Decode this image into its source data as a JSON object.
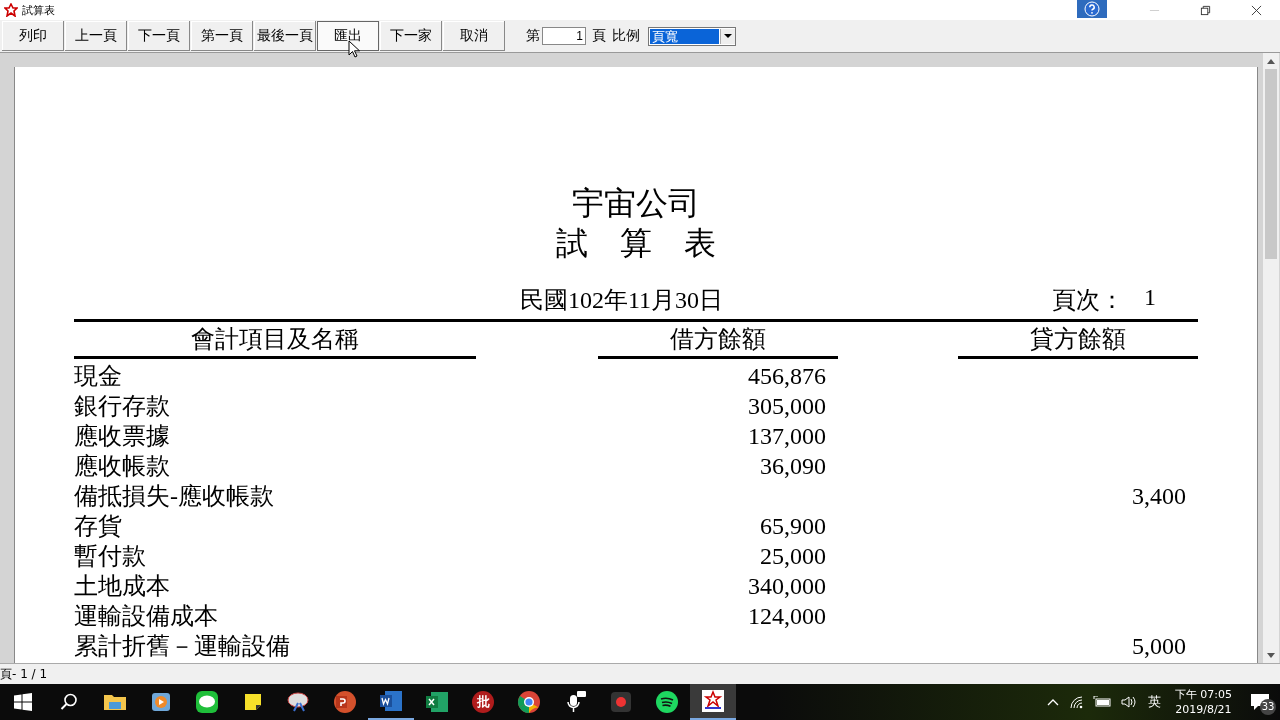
{
  "window": {
    "title": "試算表"
  },
  "toolbar": {
    "buttons": [
      {
        "label": "列印",
        "hovered": false
      },
      {
        "label": "上一頁",
        "hovered": false
      },
      {
        "label": "下一頁",
        "hovered": false
      },
      {
        "label": "第一頁",
        "hovered": false
      },
      {
        "label": "最後一頁",
        "hovered": false
      },
      {
        "label": "匯出",
        "hovered": true
      },
      {
        "label": "下一家",
        "hovered": false
      },
      {
        "label": "取消",
        "hovered": false
      }
    ],
    "page_prefix": "第",
    "page_value": "1",
    "page_suffix": "頁",
    "zoom_label": "比例",
    "zoom_value": "頁寬"
  },
  "report": {
    "company": "宇宙公司",
    "title": "試　算　表",
    "date": "民國102年11月30日",
    "page_label": "頁次：",
    "page_number": "1",
    "columns": [
      "會計項目及名稱",
      "借方餘額",
      "貸方餘額"
    ],
    "rows": [
      {
        "name": "現金",
        "debit": "456,876"
      },
      {
        "name": "銀行存款",
        "debit": "305,000"
      },
      {
        "name": "應收票據",
        "debit": "137,000"
      },
      {
        "name": "應收帳款",
        "debit": "36,090"
      },
      {
        "name": "備抵損失-應收帳款",
        "credit": "3,400"
      },
      {
        "name": "存貨",
        "debit": "65,900"
      },
      {
        "name": "暫付款",
        "debit": "25,000"
      },
      {
        "name": "土地成本",
        "debit": "340,000"
      },
      {
        "name": "運輸設備成本",
        "debit": "124,000"
      },
      {
        "name": "累計折舊－運輸設備",
        "credit": "5,000"
      }
    ]
  },
  "status_bar": {
    "text": "頁- 1 / 1"
  },
  "taskbar": {
    "app_char": "批",
    "language": "英",
    "time": "下午 07:05",
    "date": "2019/8/21",
    "notifications": "33"
  }
}
